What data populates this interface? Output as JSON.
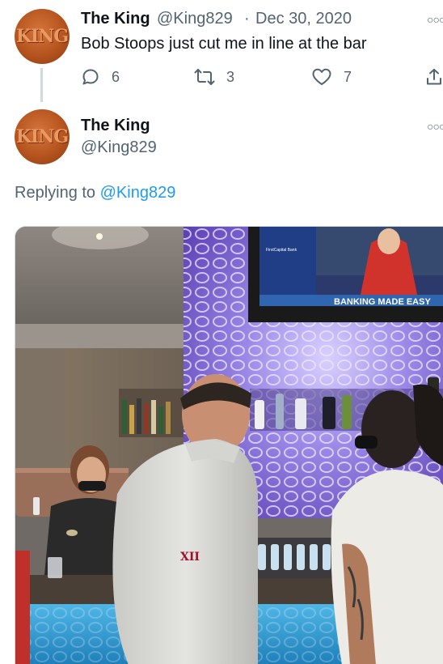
{
  "parent_tweet": {
    "avatar_text": "KING",
    "name": "The King",
    "handle": "@King829",
    "separator": "·",
    "date": "Dec 30, 2020",
    "text": "Bob Stoops just cut me in line at the bar",
    "reply_count": "6",
    "retweet_count": "3",
    "like_count": "7"
  },
  "reply_tweet": {
    "avatar_text": "KING",
    "name": "The King",
    "handle": "@King829",
    "replying_prefix": "Replying to",
    "replying_mention": "@King829"
  },
  "photo": {
    "tv_banner": "BANKING MADE EASY",
    "tv_logo": "FirstCapital Bank",
    "jacket_logo": "XII"
  },
  "colors": {
    "link": "#1d9bf0",
    "secondary_text": "#536471",
    "primary_text": "#0f1419"
  }
}
